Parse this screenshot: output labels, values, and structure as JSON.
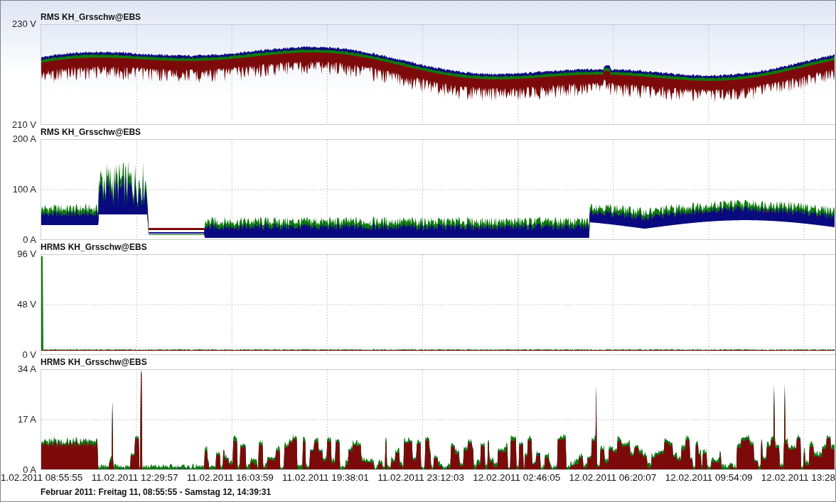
{
  "panels": [
    {
      "title": "RMS KH_Grsschw@EBS",
      "kind": "voltage",
      "y_labels": [
        "230 V",
        "210 V"
      ]
    },
    {
      "title": "RMS KH_Grsschw@EBS",
      "kind": "current",
      "y_labels": [
        "200 A",
        "100 A",
        "0 A"
      ]
    },
    {
      "title": "HRMS KH_Grsschw@EBS",
      "kind": "harmonic_voltage",
      "y_labels": [
        "96 V",
        "48 V",
        "0 V"
      ]
    },
    {
      "title": "HRMS KH_Grsschw@EBS",
      "kind": "harmonic_current",
      "y_labels": [
        "34 A",
        "17 A",
        "0 A"
      ]
    }
  ],
  "x_labels": [
    "1.02.2011 08:55:55",
    "11.02.2011 12:29:57",
    "11.02.2011 16:03:59",
    "11.02.2011 19:38:01",
    "11.02.2011 23:12:03",
    "12.02.2011 02:46:05",
    "12.02.2011 06:20:07",
    "12.02.2011 09:54:09",
    "12.02.2011 13:28"
  ],
  "footer": "Februar 2011: Freitag 11, 08:55:55 - Samstag 12, 14:39:31"
}
